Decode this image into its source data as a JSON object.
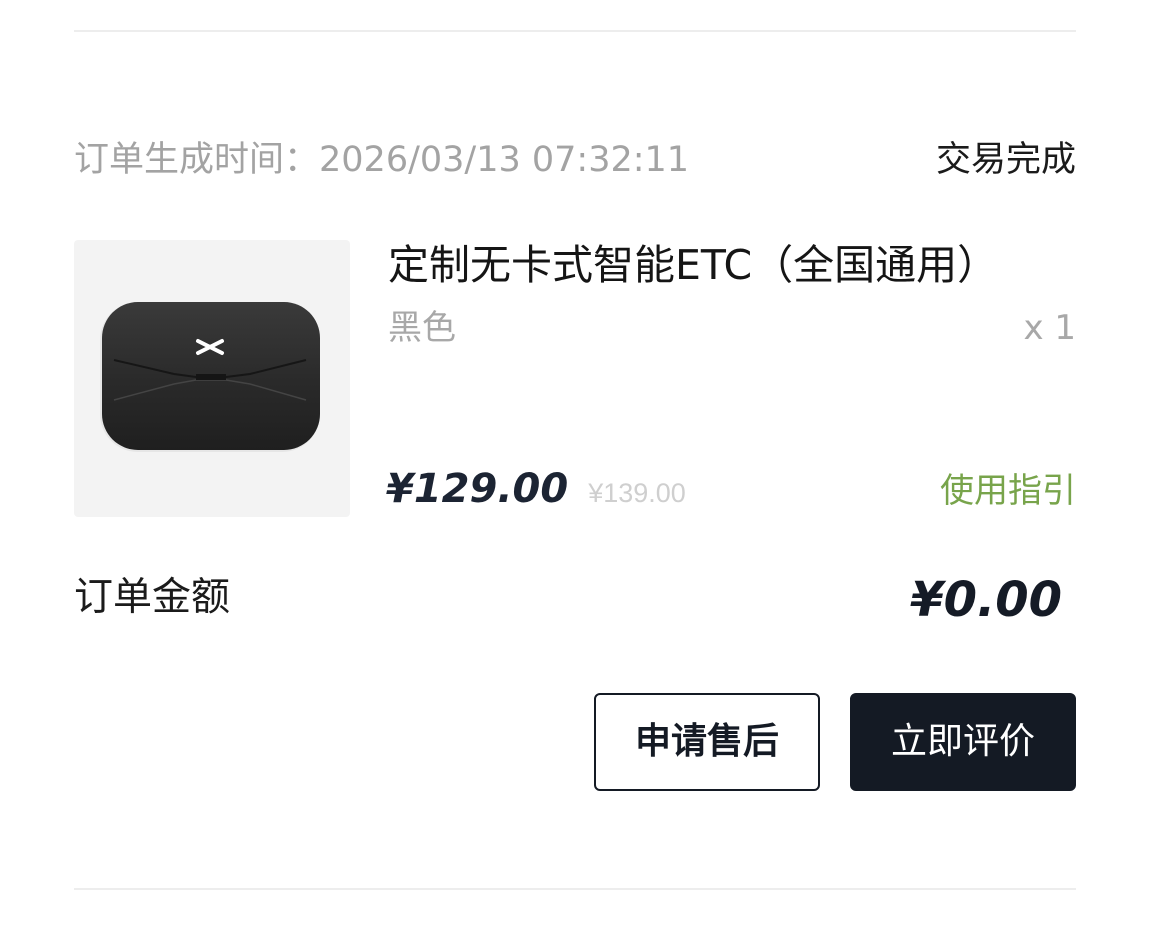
{
  "order": {
    "time_label": "订单生成时间：",
    "time_value": "2026/03/13 07:32:11",
    "status": "交易完成"
  },
  "product": {
    "image_icon": "etc-device-image",
    "name": "定制无卡式智能ETC（全国通用）",
    "variant": "黑色",
    "quantity": "x 1",
    "price": "¥129.00",
    "original_price": "¥139.00",
    "usage_guide": "使用指引"
  },
  "total": {
    "label": "订单金额",
    "value": "¥0.00"
  },
  "actions": {
    "after_sale": "申请售后",
    "review": "立即评价"
  },
  "colors": {
    "primary_dark": "#141a24",
    "accent_green": "#78a44b",
    "muted_text": "#a3a3a3",
    "divider": "#ededed"
  }
}
